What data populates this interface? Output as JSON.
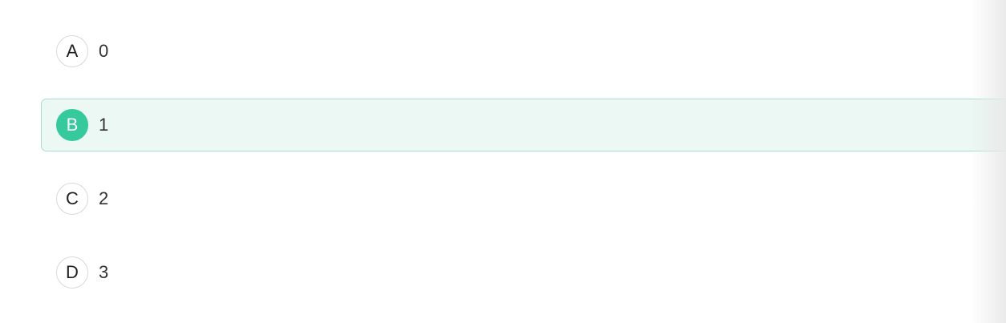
{
  "options": [
    {
      "letter": "A",
      "text": "0",
      "selected": false
    },
    {
      "letter": "B",
      "text": "1",
      "selected": true
    },
    {
      "letter": "C",
      "text": "2",
      "selected": false
    },
    {
      "letter": "D",
      "text": "3",
      "selected": false
    }
  ],
  "colors": {
    "accent": "#35c99c",
    "selected_background": "#ebf8f4",
    "selected_border": "#a7dfcd"
  }
}
